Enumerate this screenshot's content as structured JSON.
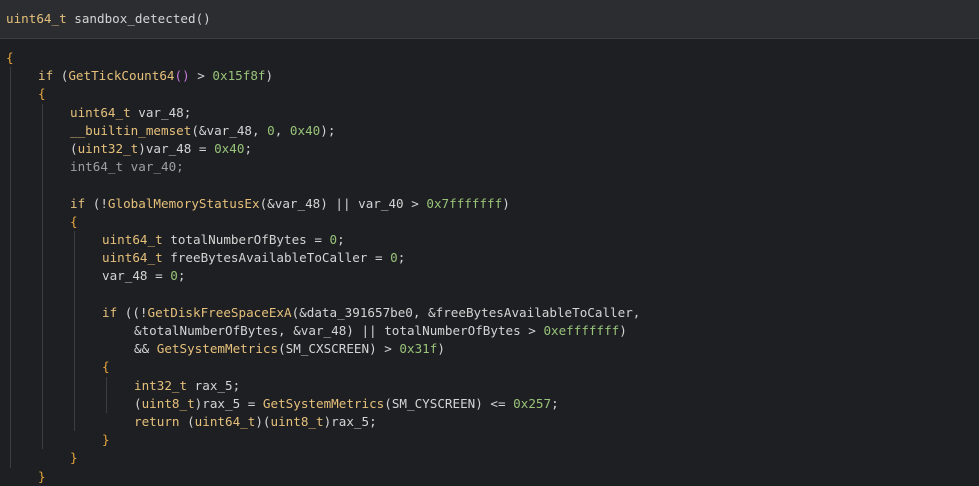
{
  "header": {
    "return_type": "uint64_t",
    "func_name": "sandbox_detected",
    "parens": "()"
  },
  "code": {
    "lines": [
      {
        "segments": [
          {
            "t": "{",
            "c": "brace"
          }
        ],
        "indent": 0
      },
      {
        "segments": [
          {
            "t": "if",
            "c": "kw"
          },
          {
            "t": " (",
            "c": "op"
          },
          {
            "t": "GetTickCount64",
            "c": "fn"
          },
          {
            "t": "()",
            "c": "paren"
          },
          {
            "t": " > ",
            "c": "op"
          },
          {
            "t": "0x15f8f",
            "c": "num"
          },
          {
            "t": ")",
            "c": "op"
          }
        ],
        "indent": 1
      },
      {
        "segments": [
          {
            "t": "{",
            "c": "brace"
          }
        ],
        "indent": 1
      },
      {
        "segments": [
          {
            "t": "uint64_t",
            "c": "ty"
          },
          {
            "t": " var_48;",
            "c": "var"
          }
        ],
        "indent": 2
      },
      {
        "segments": [
          {
            "t": "__builtin_memset",
            "c": "fn"
          },
          {
            "t": "(&var_48, ",
            "c": "var"
          },
          {
            "t": "0",
            "c": "num"
          },
          {
            "t": ", ",
            "c": "var"
          },
          {
            "t": "0x40",
            "c": "num"
          },
          {
            "t": ");",
            "c": "var"
          }
        ],
        "indent": 2
      },
      {
        "segments": [
          {
            "t": "(",
            "c": "op"
          },
          {
            "t": "uint32_t",
            "c": "ty"
          },
          {
            "t": ")var_48 = ",
            "c": "var"
          },
          {
            "t": "0x40",
            "c": "num"
          },
          {
            "t": ";",
            "c": "var"
          }
        ],
        "indent": 2
      },
      {
        "segments": [
          {
            "t": "int64_t var_40;",
            "c": "dim"
          }
        ],
        "indent": 2
      },
      {
        "segments": [],
        "indent": 2
      },
      {
        "segments": [
          {
            "t": "if",
            "c": "kw"
          },
          {
            "t": " (!",
            "c": "op"
          },
          {
            "t": "GlobalMemoryStatusEx",
            "c": "fn"
          },
          {
            "t": "(&var_48) || var_40 > ",
            "c": "var"
          },
          {
            "t": "0x7fffffff",
            "c": "num"
          },
          {
            "t": ")",
            "c": "op"
          }
        ],
        "indent": 2
      },
      {
        "segments": [
          {
            "t": "{",
            "c": "brace"
          }
        ],
        "indent": 2
      },
      {
        "segments": [
          {
            "t": "uint64_t",
            "c": "ty"
          },
          {
            "t": " totalNumberOfBytes = ",
            "c": "var"
          },
          {
            "t": "0",
            "c": "num"
          },
          {
            "t": ";",
            "c": "var"
          }
        ],
        "indent": 3
      },
      {
        "segments": [
          {
            "t": "uint64_t",
            "c": "ty"
          },
          {
            "t": " freeBytesAvailableToCaller = ",
            "c": "var"
          },
          {
            "t": "0",
            "c": "num"
          },
          {
            "t": ";",
            "c": "var"
          }
        ],
        "indent": 3
      },
      {
        "segments": [
          {
            "t": "var_48 = ",
            "c": "var"
          },
          {
            "t": "0",
            "c": "num"
          },
          {
            "t": ";",
            "c": "var"
          }
        ],
        "indent": 3
      },
      {
        "segments": [],
        "indent": 3
      },
      {
        "segments": [
          {
            "t": "if",
            "c": "kw"
          },
          {
            "t": " ((!",
            "c": "op"
          },
          {
            "t": "GetDiskFreeSpaceExA",
            "c": "fn"
          },
          {
            "t": "(&data_391657be0, &freeBytesAvailableToCaller,",
            "c": "var"
          }
        ],
        "indent": 3
      },
      {
        "segments": [
          {
            "t": "&totalNumberOfBytes, &var_48) || totalNumberOfBytes > ",
            "c": "var"
          },
          {
            "t": "0xefffffff",
            "c": "num"
          },
          {
            "t": ")",
            "c": "op"
          }
        ],
        "indent": 4
      },
      {
        "segments": [
          {
            "t": "&& ",
            "c": "op"
          },
          {
            "t": "GetSystemMetrics",
            "c": "fn"
          },
          {
            "t": "(SM_CXSCREEN) > ",
            "c": "var"
          },
          {
            "t": "0x31f",
            "c": "num"
          },
          {
            "t": ")",
            "c": "op"
          }
        ],
        "indent": 4
      },
      {
        "segments": [
          {
            "t": "{",
            "c": "brace"
          }
        ],
        "indent": 3
      },
      {
        "segments": [
          {
            "t": "int32_t",
            "c": "ty"
          },
          {
            "t": " rax_5;",
            "c": "var"
          }
        ],
        "indent": 4
      },
      {
        "segments": [
          {
            "t": "(",
            "c": "op"
          },
          {
            "t": "uint8_t",
            "c": "ty"
          },
          {
            "t": ")rax_5 = ",
            "c": "var"
          },
          {
            "t": "GetSystemMetrics",
            "c": "fn"
          },
          {
            "t": "(SM_CYSCREEN) <= ",
            "c": "var"
          },
          {
            "t": "0x257",
            "c": "num"
          },
          {
            "t": ";",
            "c": "var"
          }
        ],
        "indent": 4
      },
      {
        "segments": [
          {
            "t": "return",
            "c": "kw"
          },
          {
            "t": " (",
            "c": "op"
          },
          {
            "t": "uint64_t",
            "c": "ty"
          },
          {
            "t": ")(",
            "c": "op"
          },
          {
            "t": "uint8_t",
            "c": "ty"
          },
          {
            "t": ")rax_5;",
            "c": "var"
          }
        ],
        "indent": 4
      },
      {
        "segments": [
          {
            "t": "}",
            "c": "brace"
          }
        ],
        "indent": 3
      },
      {
        "segments": [
          {
            "t": "}",
            "c": "brace"
          }
        ],
        "indent": 2
      },
      {
        "segments": [
          {
            "t": "}",
            "c": "brace"
          }
        ],
        "indent": 1
      }
    ]
  },
  "colors": {
    "background": "#1e1f22",
    "header_background": "#2b2d31",
    "type_yellow": "#e5c07b",
    "number_green": "#98c379",
    "brace_orange": "#e5a53d"
  }
}
